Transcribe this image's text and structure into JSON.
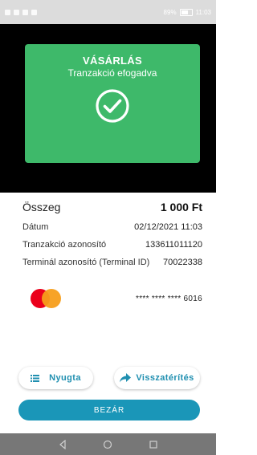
{
  "status_bar": {
    "battery": "89%",
    "time": "11:03"
  },
  "result": {
    "title": "VÁSÁRLÁS",
    "subtitle": "Tranzakció efogadva",
    "icon": "check-circle-icon",
    "color": "#3eb96a"
  },
  "details": {
    "amount_label": "Összeg",
    "amount_value": "1 000 Ft",
    "date_label": "Dátum",
    "date_value": "02/12/2021 11:03",
    "txn_label": "Tranzakció azonosító",
    "txn_value": "133611011120",
    "terminal_label": "Terminál azonosító (Terminal ID)",
    "terminal_value": "70022338"
  },
  "card": {
    "brand": "mastercard",
    "masked_number": "**** **** **** 6016"
  },
  "actions": {
    "receipt_label": "Nyugta",
    "refund_label": "Visszatérítés",
    "close_label": "BEZÁR",
    "accent": "#1a96b8"
  }
}
